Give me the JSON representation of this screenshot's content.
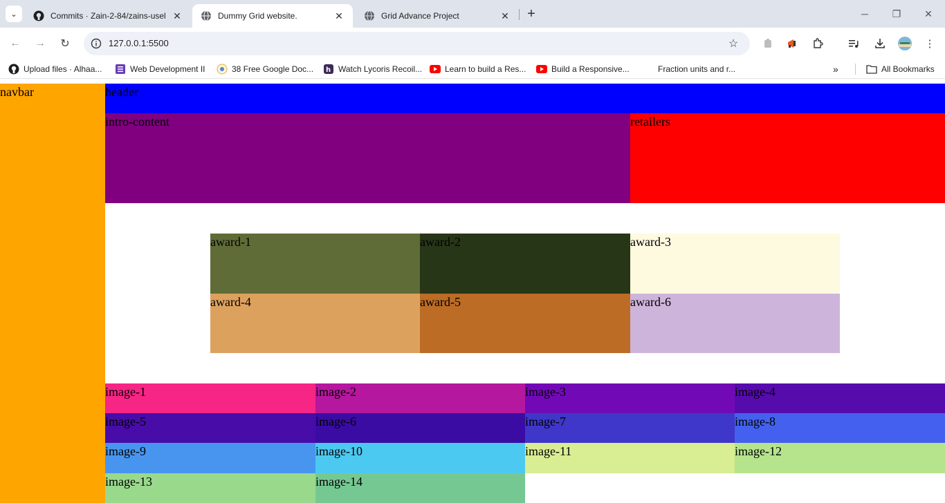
{
  "browser": {
    "tabs": [
      {
        "title": "Commits · Zain-2-84/zains-usel",
        "active": false,
        "icon": "github-icon"
      },
      {
        "title": "Dummy Grid website.",
        "active": true,
        "icon": "globe-icon"
      },
      {
        "title": "Grid Advance Project",
        "active": false,
        "icon": "globe-icon"
      }
    ],
    "url": "127.0.0.1:5500",
    "bookmarks": [
      {
        "label": "Upload files · Alhaa...",
        "icon": "github-icon"
      },
      {
        "label": "Web Development II",
        "icon": "forms-icon"
      },
      {
        "label": "38 Free Google Doc...",
        "icon": "docs-icon"
      },
      {
        "label": "Watch Lycoris Recoil...",
        "icon": "h-icon"
      },
      {
        "label": "Learn to build a Res...",
        "icon": "youtube-icon"
      },
      {
        "label": "Build a Responsive...",
        "icon": "youtube-icon"
      },
      {
        "label": "Fraction units and r...",
        "icon": "blank-icon"
      }
    ],
    "all_bookmarks": "All Bookmarks",
    "overflow": "»"
  },
  "colors": {
    "navbar": "#ffa500",
    "header": "#0000ff",
    "intro": "#800080",
    "retailers": "#ff0000",
    "awards": [
      "#5f6c37",
      "#283618",
      "#fefae0",
      "#dda15e",
      "#bc6c25",
      "#cdb4db"
    ],
    "images": [
      "#f72585",
      "#b5179e",
      "#7209b7",
      "#560bad",
      "#480ca8",
      "#3a0ca3",
      "#3f37c9",
      "#4361ee",
      "#4895ef",
      "#4cc9f0",
      "#d9ed92",
      "#b5e48c",
      "#99d98c",
      "#76c893"
    ]
  },
  "grid": {
    "navbar": "navbar",
    "header": "header",
    "intro": "intro-content",
    "retailers": "retailers",
    "awards": [
      "award-1",
      "award-2",
      "award-3",
      "award-4",
      "award-5",
      "award-6"
    ],
    "images": [
      "image-1",
      "image-2",
      "image-3",
      "image-4",
      "image-5",
      "image-6",
      "image-7",
      "image-8",
      "image-9",
      "image-10",
      "image-11",
      "image-12",
      "image-13",
      "image-14"
    ]
  }
}
